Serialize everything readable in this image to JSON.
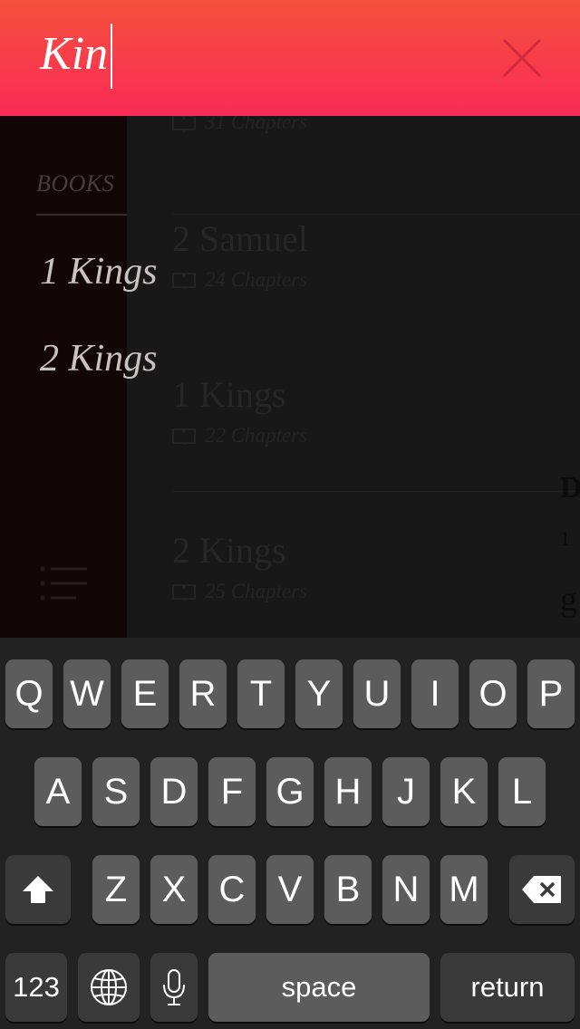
{
  "search": {
    "query": "Kin"
  },
  "sidebar": {
    "header": "BOOKS",
    "results": [
      {
        "label": "1 Kings"
      },
      {
        "label": "2 Kings"
      }
    ]
  },
  "background": {
    "rows": [
      {
        "title": "",
        "meta": "31 Chapters"
      },
      {
        "title": "2 Samuel",
        "meta": "24 Chapters"
      },
      {
        "title": "1 Kings",
        "meta": "22 Chapters"
      },
      {
        "title": "2 Kings",
        "meta": "25 Chapters"
      }
    ],
    "right_snippets": [
      "D",
      "1",
      "g"
    ]
  },
  "keyboard": {
    "row1": [
      "Q",
      "W",
      "E",
      "R",
      "T",
      "Y",
      "U",
      "I",
      "O",
      "P"
    ],
    "row2": [
      "A",
      "S",
      "D",
      "F",
      "G",
      "H",
      "J",
      "K",
      "L"
    ],
    "row3": [
      "Z",
      "X",
      "C",
      "V",
      "B",
      "N",
      "M"
    ],
    "numbers": "123",
    "space": "space",
    "return": "return"
  },
  "colors": {
    "header_top": "#f4503c",
    "header_bottom": "#fb2b57",
    "sidebar_bg": "#120606",
    "keyboard_bg": "#222222",
    "key_bg": "#5c5c5c"
  },
  "icons": [
    "close-icon",
    "book-icon",
    "menu-list-icon",
    "shift-icon",
    "backspace-icon",
    "globe-icon",
    "microphone-icon"
  ]
}
